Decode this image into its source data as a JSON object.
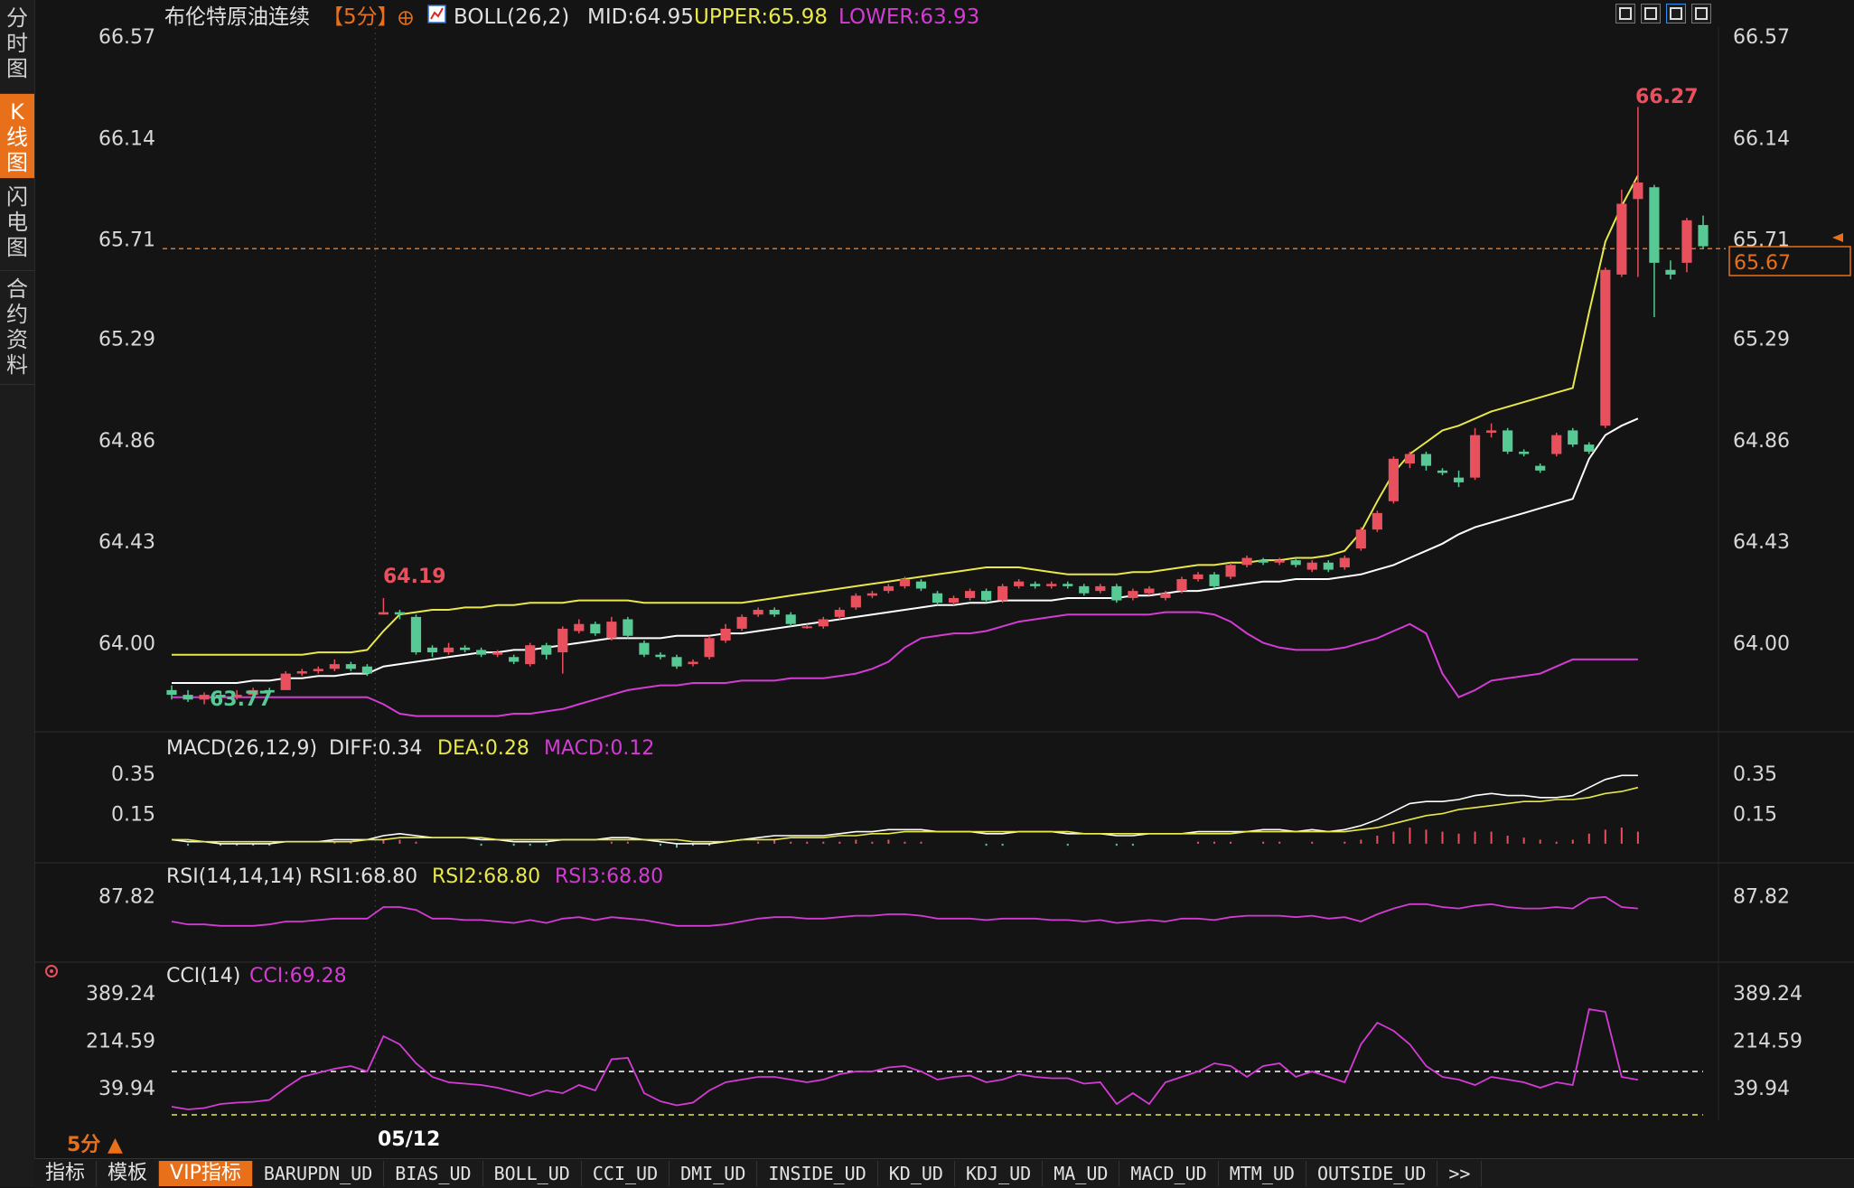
{
  "left_tabs": [
    {
      "label": "分时图",
      "active": false
    },
    {
      "label": "K线图",
      "active": true
    },
    {
      "label": "闪电图",
      "active": false
    },
    {
      "label": "合约资料",
      "active": false
    }
  ],
  "header": {
    "instrument": "布伦特原油连续",
    "period": "【5分】",
    "boll_label": "BOLL(26,2)",
    "mid": "MID:64.95",
    "upper": "UPPER:65.98",
    "lower": "LOWER:63.93"
  },
  "colors": {
    "up": "#e8505e",
    "down": "#56c994",
    "mid": "#ffffff",
    "upper": "#e8e84a",
    "lower": "#d43bd4",
    "axis_text": "#d8d8d8",
    "accent": "#e8701a",
    "grid": "#2a2a2a"
  },
  "price_axis": {
    "ticks": [
      "66.57",
      "66.14",
      "65.71",
      "65.29",
      "64.86",
      "64.43",
      "64.00"
    ],
    "current": "65.67",
    "high_label": "66.27",
    "low_label": "63.77",
    "low_left_label": "64.19"
  },
  "macd": {
    "title": "MACD(26,12,9)",
    "diff": "DIFF:0.34",
    "dea": "DEA:0.28",
    "macd": "MACD:0.12",
    "ticks": [
      "0.35",
      "0.15"
    ]
  },
  "rsi": {
    "title": "RSI(14,14,14)",
    "rsi1": "RSI1:68.80",
    "rsi2": "RSI2:68.80",
    "rsi3": "RSI3:68.80",
    "ticks": [
      "87.82"
    ]
  },
  "cci": {
    "title": "CCI(14)",
    "cci": "CCI:69.28",
    "ticks": [
      "389.24",
      "214.59",
      "39.94"
    ]
  },
  "date_label": "05/12",
  "period_indicator": "5分 ▲",
  "bottom_tabs": [
    "指标",
    "模板",
    "VIP指标",
    "BARUPDN_UD",
    "BIAS_UD",
    "BOLL_UD",
    "CCI_UD",
    "DMI_UD",
    "INSIDE_UD",
    "KD_UD",
    "KDJ_UD",
    "MA_UD",
    "MACD_UD",
    "MTM_UD",
    "OUTSIDE_UD",
    ">>"
  ],
  "chart_data": {
    "type": "candlestick",
    "price_range": [
      63.7,
      66.57
    ],
    "candles": [
      [
        63.8,
        63.78,
        63.82,
        63.76
      ],
      [
        63.78,
        63.76,
        63.8,
        63.75
      ],
      [
        63.76,
        63.78,
        63.79,
        63.74
      ],
      [
        63.78,
        63.77,
        63.79,
        63.76
      ],
      [
        63.77,
        63.78,
        63.8,
        63.76
      ],
      [
        63.78,
        63.8,
        63.81,
        63.77
      ],
      [
        63.8,
        63.79,
        63.81,
        63.78
      ],
      [
        63.8,
        63.87,
        63.88,
        63.8
      ],
      [
        63.87,
        63.88,
        63.89,
        63.86
      ],
      [
        63.88,
        63.89,
        63.9,
        63.87
      ],
      [
        63.89,
        63.91,
        63.93,
        63.88
      ],
      [
        63.91,
        63.89,
        63.92,
        63.88
      ],
      [
        63.9,
        63.87,
        63.91,
        63.86
      ],
      [
        64.12,
        64.13,
        64.19,
        64.12
      ],
      [
        64.13,
        64.12,
        64.14,
        64.1
      ],
      [
        64.11,
        63.96,
        64.12,
        63.95
      ],
      [
        63.98,
        63.96,
        63.99,
        63.94
      ],
      [
        63.96,
        63.98,
        64.0,
        63.95
      ],
      [
        63.98,
        63.97,
        63.99,
        63.96
      ],
      [
        63.97,
        63.95,
        63.98,
        63.94
      ],
      [
        63.95,
        63.96,
        63.97,
        63.94
      ],
      [
        63.94,
        63.92,
        63.95,
        63.91
      ],
      [
        63.91,
        63.99,
        64.0,
        63.9
      ],
      [
        63.99,
        63.95,
        64.0,
        63.93
      ],
      [
        63.96,
        64.06,
        64.07,
        63.87
      ],
      [
        64.05,
        64.08,
        64.1,
        64.04
      ],
      [
        64.08,
        64.04,
        64.09,
        64.03
      ],
      [
        64.02,
        64.09,
        64.11,
        64.01
      ],
      [
        64.1,
        64.03,
        64.11,
        64.02
      ],
      [
        64.0,
        63.95,
        64.01,
        63.94
      ],
      [
        63.95,
        63.94,
        63.96,
        63.93
      ],
      [
        63.94,
        63.9,
        63.95,
        63.89
      ],
      [
        63.91,
        63.92,
        63.93,
        63.9
      ],
      [
        63.94,
        64.02,
        64.03,
        63.93
      ],
      [
        64.01,
        64.06,
        64.08,
        64.0
      ],
      [
        64.06,
        64.11,
        64.12,
        64.05
      ],
      [
        64.12,
        64.14,
        64.15,
        64.11
      ],
      [
        64.14,
        64.12,
        64.15,
        64.11
      ],
      [
        64.12,
        64.08,
        64.13,
        64.07
      ],
      [
        64.07,
        64.07,
        64.08,
        64.06
      ],
      [
        64.07,
        64.1,
        64.11,
        64.06
      ],
      [
        64.11,
        64.14,
        64.15,
        64.1
      ],
      [
        64.15,
        64.2,
        64.21,
        64.14
      ],
      [
        64.2,
        64.21,
        64.22,
        64.19
      ],
      [
        64.22,
        64.24,
        64.25,
        64.21
      ],
      [
        64.24,
        64.27,
        64.28,
        64.23
      ],
      [
        64.26,
        64.23,
        64.27,
        64.22
      ],
      [
        64.21,
        64.17,
        64.22,
        64.16
      ],
      [
        64.17,
        64.19,
        64.2,
        64.16
      ],
      [
        64.19,
        64.22,
        64.23,
        64.18
      ],
      [
        64.22,
        64.18,
        64.23,
        64.17
      ],
      [
        64.18,
        64.24,
        64.25,
        64.17
      ],
      [
        64.24,
        64.26,
        64.27,
        64.23
      ],
      [
        64.25,
        64.24,
        64.26,
        64.23
      ],
      [
        64.24,
        64.25,
        64.26,
        64.23
      ],
      [
        64.25,
        64.24,
        64.26,
        64.23
      ],
      [
        64.24,
        64.21,
        64.25,
        64.2
      ],
      [
        64.22,
        64.24,
        64.25,
        64.21
      ],
      [
        64.24,
        64.18,
        64.25,
        64.17
      ],
      [
        64.19,
        64.22,
        64.23,
        64.18
      ],
      [
        64.21,
        64.23,
        64.24,
        64.2
      ],
      [
        64.19,
        64.21,
        64.22,
        64.18
      ],
      [
        64.22,
        64.27,
        64.28,
        64.21
      ],
      [
        64.27,
        64.29,
        64.3,
        64.26
      ],
      [
        64.29,
        64.24,
        64.3,
        64.23
      ],
      [
        64.28,
        64.33,
        64.34,
        64.27
      ],
      [
        64.33,
        64.36,
        64.37,
        64.32
      ],
      [
        64.35,
        64.34,
        64.36,
        64.33
      ],
      [
        64.34,
        64.35,
        64.36,
        64.33
      ],
      [
        64.35,
        64.33,
        64.36,
        64.32
      ],
      [
        64.31,
        64.34,
        64.35,
        64.3
      ],
      [
        64.34,
        64.31,
        64.35,
        64.3
      ],
      [
        64.32,
        64.36,
        64.37,
        64.31
      ],
      [
        64.4,
        64.48,
        64.49,
        64.39
      ],
      [
        64.48,
        64.55,
        64.56,
        64.47
      ],
      [
        64.6,
        64.78,
        64.79,
        64.59
      ],
      [
        64.76,
        64.8,
        64.81,
        64.74
      ],
      [
        64.8,
        64.75,
        64.81,
        64.73
      ],
      [
        64.73,
        64.72,
        64.74,
        64.71
      ],
      [
        64.7,
        64.68,
        64.73,
        64.66
      ],
      [
        64.7,
        64.88,
        64.91,
        64.69
      ],
      [
        64.89,
        64.9,
        64.93,
        64.87
      ],
      [
        64.9,
        64.81,
        64.91,
        64.8
      ],
      [
        64.81,
        64.8,
        64.82,
        64.79
      ],
      [
        64.75,
        64.73,
        64.76,
        64.72
      ],
      [
        64.8,
        64.88,
        64.89,
        64.79
      ],
      [
        64.9,
        64.84,
        64.91,
        64.83
      ],
      [
        64.84,
        64.81,
        64.85,
        64.8
      ],
      [
        64.92,
        65.58,
        65.59,
        64.91
      ],
      [
        65.56,
        65.86,
        65.92,
        65.55
      ],
      [
        65.88,
        65.95,
        66.27,
        65.55
      ],
      [
        65.93,
        65.61,
        65.94,
        65.38
      ],
      [
        65.58,
        65.56,
        65.62,
        65.54
      ],
      [
        65.61,
        65.79,
        65.8,
        65.57
      ],
      [
        65.77,
        65.68,
        65.81,
        65.67
      ]
    ],
    "boll_mid": [
      63.83,
      63.83,
      63.83,
      63.83,
      63.83,
      63.84,
      63.84,
      63.85,
      63.85,
      63.86,
      63.86,
      63.87,
      63.87,
      63.9,
      63.91,
      63.92,
      63.93,
      63.94,
      63.95,
      63.96,
      63.96,
      63.97,
      63.97,
      63.98,
      63.99,
      64.0,
      64.01,
      64.02,
      64.02,
      64.02,
      64.02,
      64.03,
      64.03,
      64.03,
      64.04,
      64.04,
      64.05,
      64.06,
      64.07,
      64.08,
      64.09,
      64.1,
      64.11,
      64.12,
      64.13,
      64.14,
      64.15,
      64.16,
      64.16,
      64.17,
      64.17,
      64.18,
      64.18,
      64.18,
      64.18,
      64.19,
      64.19,
      64.19,
      64.19,
      64.2,
      64.2,
      64.21,
      64.22,
      64.22,
      64.23,
      64.24,
      64.25,
      64.26,
      64.26,
      64.27,
      64.27,
      64.27,
      64.28,
      64.29,
      64.31,
      64.33,
      64.36,
      64.39,
      64.42,
      64.46,
      64.49,
      64.51,
      64.53,
      64.55,
      64.57,
      64.59,
      64.61,
      64.78,
      64.88,
      64.92,
      64.95
    ],
    "boll_upper": [
      63.95,
      63.95,
      63.95,
      63.95,
      63.95,
      63.95,
      63.95,
      63.95,
      63.95,
      63.96,
      63.96,
      63.96,
      63.97,
      64.05,
      64.12,
      64.13,
      64.14,
      64.14,
      64.15,
      64.15,
      64.16,
      64.16,
      64.17,
      64.17,
      64.17,
      64.18,
      64.18,
      64.18,
      64.18,
      64.17,
      64.17,
      64.17,
      64.17,
      64.17,
      64.17,
      64.17,
      64.18,
      64.19,
      64.2,
      64.21,
      64.22,
      64.23,
      64.24,
      64.25,
      64.26,
      64.27,
      64.28,
      64.29,
      64.3,
      64.31,
      64.32,
      64.32,
      64.32,
      64.31,
      64.3,
      64.29,
      64.29,
      64.29,
      64.29,
      64.3,
      64.3,
      64.31,
      64.32,
      64.33,
      64.33,
      64.34,
      64.34,
      64.35,
      64.35,
      64.36,
      64.36,
      64.37,
      64.39,
      64.47,
      64.6,
      64.72,
      64.8,
      64.85,
      64.9,
      64.92,
      64.95,
      64.98,
      65.0,
      65.02,
      65.04,
      65.06,
      65.08,
      65.4,
      65.7,
      65.85,
      65.98
    ],
    "boll_lower": [
      63.77,
      63.77,
      63.77,
      63.77,
      63.77,
      63.77,
      63.77,
      63.77,
      63.77,
      63.77,
      63.77,
      63.77,
      63.77,
      63.74,
      63.7,
      63.69,
      63.69,
      63.69,
      63.69,
      63.69,
      63.69,
      63.7,
      63.7,
      63.71,
      63.72,
      63.74,
      63.76,
      63.78,
      63.8,
      63.81,
      63.82,
      63.82,
      63.83,
      63.83,
      63.83,
      63.84,
      63.84,
      63.84,
      63.85,
      63.85,
      63.85,
      63.86,
      63.87,
      63.89,
      63.92,
      63.98,
      64.02,
      64.03,
      64.04,
      64.04,
      64.05,
      64.07,
      64.09,
      64.1,
      64.11,
      64.12,
      64.12,
      64.12,
      64.12,
      64.12,
      64.12,
      64.13,
      64.13,
      64.13,
      64.12,
      64.09,
      64.04,
      64.0,
      63.98,
      63.97,
      63.97,
      63.97,
      63.98,
      64.0,
      64.02,
      64.05,
      64.08,
      64.04,
      63.87,
      63.77,
      63.8,
      63.84,
      63.85,
      63.86,
      63.87,
      63.9,
      63.93,
      63.93,
      63.93,
      63.93,
      63.93
    ],
    "macd": {
      "range": [
        -0.05,
        0.4
      ],
      "diff": [
        0.02,
        0.01,
        0.01,
        0.0,
        0.0,
        0.0,
        0.0,
        0.01,
        0.01,
        0.01,
        0.02,
        0.02,
        0.02,
        0.04,
        0.05,
        0.04,
        0.03,
        0.03,
        0.03,
        0.02,
        0.02,
        0.01,
        0.01,
        0.01,
        0.02,
        0.02,
        0.02,
        0.03,
        0.03,
        0.02,
        0.01,
        0.0,
        0.0,
        0.0,
        0.01,
        0.02,
        0.03,
        0.04,
        0.04,
        0.04,
        0.04,
        0.05,
        0.06,
        0.06,
        0.07,
        0.07,
        0.07,
        0.06,
        0.06,
        0.06,
        0.05,
        0.05,
        0.06,
        0.06,
        0.06,
        0.05,
        0.05,
        0.05,
        0.04,
        0.04,
        0.05,
        0.05,
        0.05,
        0.06,
        0.06,
        0.06,
        0.06,
        0.07,
        0.07,
        0.06,
        0.07,
        0.06,
        0.07,
        0.09,
        0.12,
        0.16,
        0.2,
        0.21,
        0.21,
        0.22,
        0.24,
        0.25,
        0.24,
        0.24,
        0.23,
        0.23,
        0.24,
        0.28,
        0.32,
        0.34,
        0.34
      ],
      "dea": [
        0.02,
        0.02,
        0.01,
        0.01,
        0.01,
        0.01,
        0.01,
        0.01,
        0.01,
        0.01,
        0.01,
        0.01,
        0.02,
        0.02,
        0.03,
        0.03,
        0.03,
        0.03,
        0.03,
        0.03,
        0.02,
        0.02,
        0.02,
        0.02,
        0.02,
        0.02,
        0.02,
        0.02,
        0.02,
        0.02,
        0.02,
        0.02,
        0.01,
        0.01,
        0.01,
        0.02,
        0.02,
        0.02,
        0.03,
        0.03,
        0.03,
        0.04,
        0.04,
        0.05,
        0.05,
        0.06,
        0.06,
        0.06,
        0.06,
        0.06,
        0.06,
        0.06,
        0.06,
        0.06,
        0.06,
        0.06,
        0.05,
        0.05,
        0.05,
        0.05,
        0.05,
        0.05,
        0.05,
        0.05,
        0.05,
        0.05,
        0.06,
        0.06,
        0.06,
        0.06,
        0.06,
        0.06,
        0.06,
        0.07,
        0.08,
        0.1,
        0.12,
        0.14,
        0.15,
        0.17,
        0.18,
        0.19,
        0.2,
        0.21,
        0.21,
        0.22,
        0.22,
        0.23,
        0.25,
        0.26,
        0.28
      ],
      "hist": [
        0.0,
        -0.01,
        0.0,
        -0.01,
        -0.01,
        -0.01,
        -0.01,
        0.0,
        0.0,
        0.0,
        0.01,
        0.01,
        0.0,
        0.02,
        0.02,
        0.01,
        0.0,
        0.0,
        0.0,
        -0.01,
        0.0,
        -0.01,
        -0.01,
        -0.01,
        0.0,
        0.0,
        0.0,
        0.01,
        0.01,
        0.0,
        -0.01,
        -0.02,
        -0.01,
        -0.01,
        0.0,
        0.0,
        0.01,
        0.02,
        0.01,
        0.01,
        0.01,
        0.01,
        0.02,
        0.01,
        0.02,
        0.01,
        0.01,
        0.0,
        0.0,
        0.0,
        -0.01,
        -0.01,
        0.0,
        0.0,
        0.0,
        -0.01,
        0.0,
        0.0,
        -0.01,
        -0.01,
        0.0,
        0.0,
        0.0,
        0.01,
        0.01,
        0.01,
        0.0,
        0.01,
        0.01,
        0.0,
        0.01,
        0.0,
        0.01,
        0.02,
        0.04,
        0.06,
        0.08,
        0.07,
        0.06,
        0.05,
        0.06,
        0.06,
        0.04,
        0.03,
        0.02,
        0.01,
        0.02,
        0.05,
        0.07,
        0.08,
        0.06
      ]
    },
    "rsi": {
      "range": [
        45,
        95
      ],
      "values": [
        70,
        68,
        68,
        67,
        67,
        67,
        68,
        70,
        70,
        71,
        72,
        72,
        72,
        80,
        80,
        78,
        72,
        72,
        71,
        71,
        70,
        69,
        71,
        69,
        72,
        73,
        71,
        73,
        72,
        71,
        69,
        67,
        67,
        67,
        68,
        70,
        72,
        73,
        73,
        72,
        72,
        73,
        74,
        74,
        75,
        75,
        74,
        72,
        72,
        72,
        71,
        72,
        72,
        72,
        71,
        71,
        70,
        71,
        69,
        70,
        71,
        70,
        72,
        72,
        71,
        73,
        74,
        74,
        74,
        73,
        74,
        72,
        73,
        70,
        75,
        79,
        82,
        82,
        80,
        79,
        81,
        82,
        80,
        79,
        79,
        80,
        79,
        86,
        87,
        80,
        79
      ]
    },
    "cci": {
      "range": [
        -80,
        420
      ],
      "values": [
        -30,
        -40,
        -35,
        -20,
        -15,
        -12,
        -5,
        40,
        80,
        95,
        110,
        120,
        100,
        230,
        200,
        130,
        80,
        60,
        55,
        50,
        40,
        25,
        10,
        30,
        20,
        50,
        30,
        145,
        150,
        20,
        -10,
        -25,
        -15,
        30,
        60,
        70,
        80,
        80,
        70,
        60,
        70,
        90,
        100,
        100,
        115,
        120,
        100,
        70,
        80,
        85,
        60,
        70,
        90,
        80,
        75,
        75,
        55,
        60,
        -20,
        20,
        -20,
        60,
        80,
        100,
        130,
        120,
        80,
        120,
        130,
        80,
        100,
        80,
        60,
        200,
        280,
        250,
        200,
        120,
        80,
        70,
        50,
        80,
        70,
        60,
        40,
        60,
        50,
        330,
        320,
        80,
        69
      ]
    }
  }
}
